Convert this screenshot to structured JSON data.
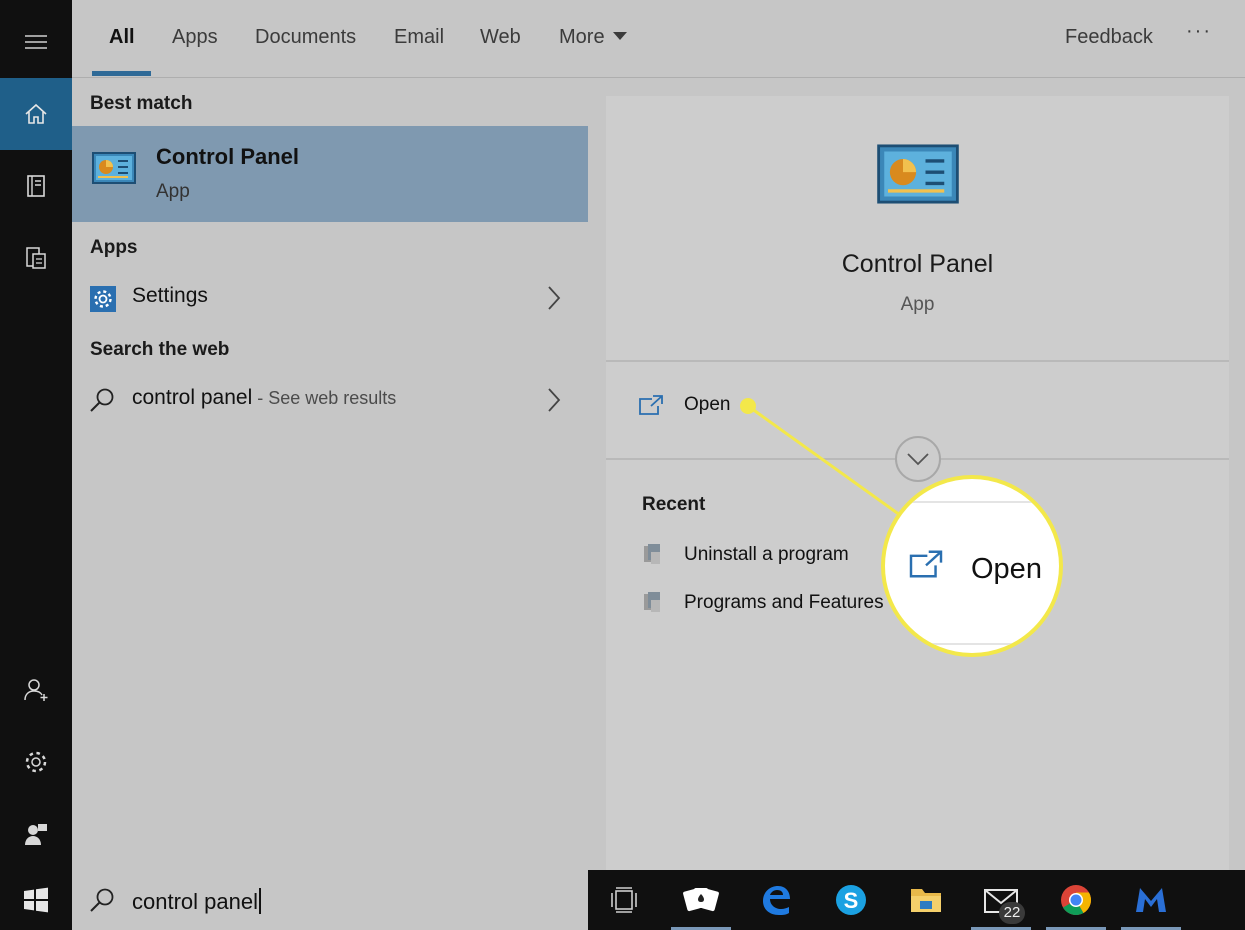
{
  "tabs": [
    {
      "label": "All"
    },
    {
      "label": "Apps"
    },
    {
      "label": "Documents"
    },
    {
      "label": "Email"
    },
    {
      "label": "Web"
    },
    {
      "label": "More"
    }
  ],
  "feedback_label": "Feedback",
  "more_options_label": "···",
  "results": {
    "best_match_heading": "Best match",
    "best_match": {
      "title": "Control Panel",
      "subtitle": "App",
      "icon": "control-panel-icon"
    },
    "apps_heading": "Apps",
    "apps": [
      {
        "label": "Settings",
        "icon": "gear-icon"
      }
    ],
    "web_heading": "Search the web",
    "web": {
      "query": "control panel",
      "hint": " - See web results"
    }
  },
  "preview": {
    "title": "Control Panel",
    "subtitle": "App",
    "open_label": "Open",
    "recent_heading": "Recent",
    "recent": [
      {
        "label": "Uninstall a program"
      },
      {
        "label": "Programs and Features"
      }
    ]
  },
  "callout": {
    "label": "Open",
    "color": "#f3e84a"
  },
  "search": {
    "value": "control panel"
  },
  "taskbar": {
    "items": [
      "task-view-icon",
      "solitaire-icon",
      "edge-icon",
      "skype-icon",
      "file-explorer-icon",
      "mail-icon",
      "chrome-icon",
      "malwarebytes-icon"
    ],
    "mail_badge": "22"
  },
  "colors": {
    "accent": "#1f5f89",
    "selection": "#7f99b0",
    "callout": "#f3e84a"
  }
}
